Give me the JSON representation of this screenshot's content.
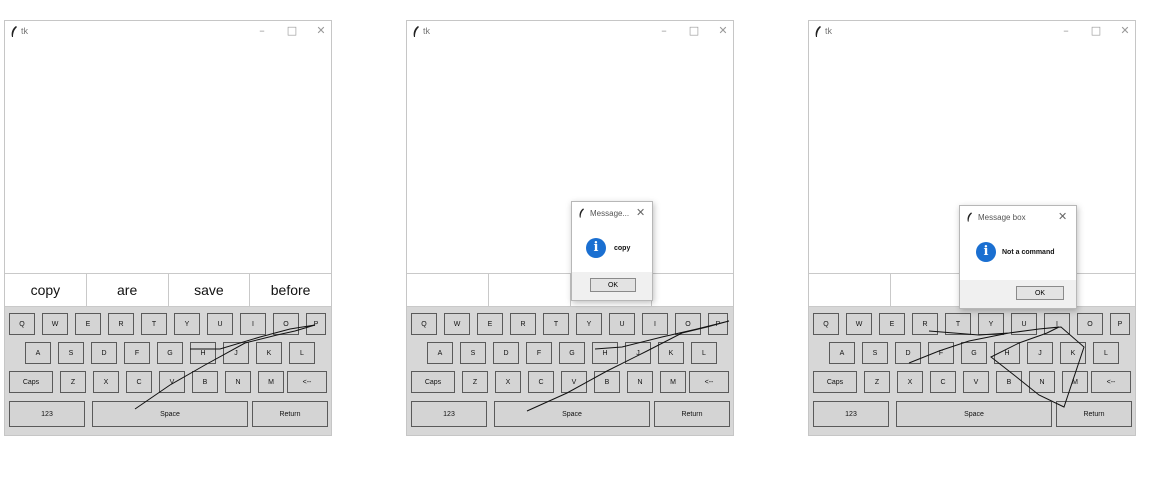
{
  "app_title": "tk",
  "window_controls": {
    "minimize": "–",
    "maximize": "□",
    "close": "✕"
  },
  "keyboard": {
    "row1": [
      "Q",
      "W",
      "E",
      "R",
      "T",
      "Y",
      "U",
      "I",
      "O",
      "P"
    ],
    "row2": [
      "A",
      "S",
      "D",
      "F",
      "G",
      "H",
      "J",
      "K",
      "L"
    ],
    "row3": [
      "Caps",
      "Z",
      "X",
      "C",
      "V",
      "B",
      "N",
      "M",
      "<--"
    ],
    "row4": [
      "123",
      "Space",
      "Return"
    ]
  },
  "panels": [
    {
      "suggestions": [
        "copy",
        "are",
        "save",
        "before"
      ],
      "dialog": null
    },
    {
      "suggestions": [
        "",
        "",
        "",
        ""
      ],
      "dialog": {
        "title": "Message...",
        "message": "copy",
        "ok_label": "OK"
      }
    },
    {
      "suggestions": [
        "",
        "",
        "",
        ""
      ],
      "dialog": {
        "title": "Message box",
        "message": "Not a command",
        "ok_label": "OK"
      }
    }
  ],
  "colors": {
    "info_icon": "#1a6fd1",
    "keyboard_bg": "#d7d7d7",
    "key_bg": "#d4d4d4"
  }
}
